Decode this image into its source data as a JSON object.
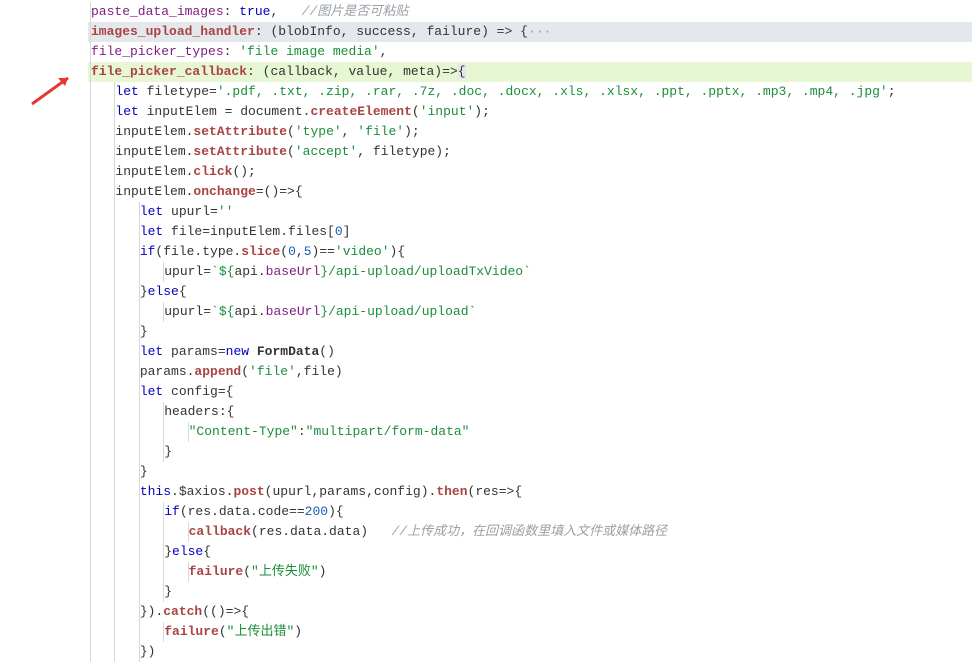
{
  "code": {
    "paste_key": "paste_data_images",
    "images_key": "images_upload_handler",
    "images_args": "(blobInfo, success, failure) => {",
    "fpt_key": "file_picker_types",
    "fpt_val": "'file image media'",
    "fpc_key": "file_picker_callback",
    "fpc_args": "(callback, value, meta)=>",
    "filetype_val": "'.pdf, .txt, .zip, .rar, .7z, .doc, .docx, .xls, .xlsx, .ppt, .pptx, .mp3, .mp4, .jpg'",
    "input_str": "'input'",
    "type_str": "'type'",
    "file_str": "'file'",
    "accept_str": "'accept'",
    "video_str": "'video'",
    "tpl_open": "`${",
    "tpl_close": "}",
    "upl_video": "/api-upload/uploadTxVideo`",
    "upl_norm": "/api-upload/upload`",
    "formdata": "FormData",
    "append": "append",
    "ct_key": "\"Content-Type\"",
    "ct_val": "\"multipart/form-data\"",
    "post": "post",
    "then": "then",
    "callback": "callback",
    "catch": "catch",
    "failure": "failure",
    "fail_upload": "\"上传失败\"",
    "fail_error": "\"上传出错\"",
    "n0": "0",
    "n5": "5",
    "n200": "200",
    "comment_paste": "//图片是否可粘贴",
    "comment_cb": "//上传成功，在回调函数里填入文件或媒体路径",
    "setAttr": "setAttribute",
    "click": "click",
    "onchange": "onchange",
    "createEl": "createElement",
    "slice": "slice",
    "baseUrl": "baseUrl",
    "let": "let",
    "new": "new",
    "this": "this",
    "if": "if",
    "else": "else",
    "true": "true",
    "dots": "···",
    "brace_o": "{",
    "brace_c": "}"
  }
}
